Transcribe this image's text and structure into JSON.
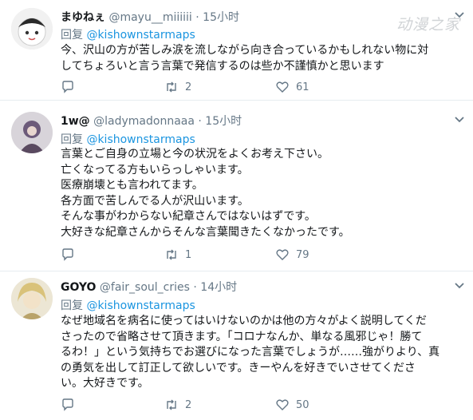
{
  "watermark": "动漫之家",
  "tweets": [
    {
      "name": "まゆねぇ",
      "handle": "@mayu__miiiiii",
      "separator": "·",
      "time": "15小时",
      "reply_prefix": "回复",
      "reply_to": "@kishownstarmaps",
      "text": "今、沢山の方が苦しみ涙を流しながら向き合っているかもしれない物に対\nしてちょろいと言う言葉で発信するのは些か不謹慎かと思います",
      "retweets": "2",
      "likes": "61"
    },
    {
      "name": "1w@",
      "handle": "@ladymadonnaaa",
      "separator": "·",
      "time": "15小时",
      "reply_prefix": "回复",
      "reply_to": "@kishownstarmaps",
      "text": "言葉とご自身の立場と今の状況をよくお考え下さい。\n亡くなってる方もいらっしゃいます。\n医療崩壊とも言われてます。\n各方面で苦しんでる人が沢山います。\nそんな事がわからない紀章さんではないはずです。\n大好きな紀章さんからそんな言葉聞きたくなかったです。",
      "retweets": "1",
      "likes": "79"
    },
    {
      "name": "GOYO",
      "handle": "@fair_soul_cries",
      "separator": "·",
      "time": "14小时",
      "reply_prefix": "回复",
      "reply_to": "@kishownstarmaps",
      "text": "なぜ地域名を病名に使ってはいけないのかは他の方々がよく説明してくだ\nさったので省略させて頂きます。「コロナなんか、単なる風邪じゃ！勝て\nるわ！」という気持ちでお選びになった言葉でしょうが……強がりより、真\nの勇気を出して訂正して欲しいです。きーやんを好きでいさせてくださ\nい。大好きです。",
      "retweets": "2",
      "likes": "50"
    }
  ],
  "icons": [
    "reply-icon",
    "retweet-icon",
    "like-icon",
    "chevron-down-icon"
  ]
}
